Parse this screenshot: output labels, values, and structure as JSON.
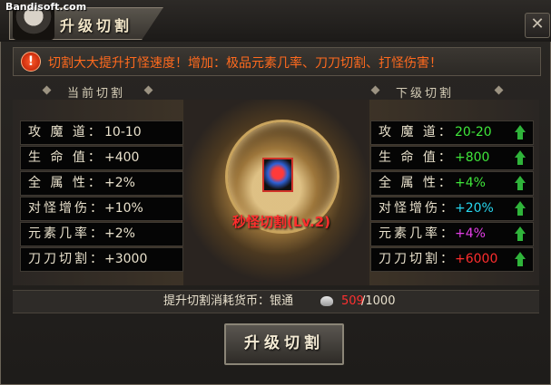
{
  "watermark": "Bandisoft.com",
  "window": {
    "title": "升级切割",
    "close_label": "✕"
  },
  "notice": {
    "icon": "alert-icon",
    "icon_glyph": "!",
    "text": "切割大大提升打怪速度！增加：极品元素几率、刀刀切割、打怪伤害！"
  },
  "current": {
    "header": "当前切割",
    "rows": [
      {
        "label": "攻 魔 道：",
        "value": "10-10"
      },
      {
        "label": "生  命  值：",
        "value": "+400"
      },
      {
        "label": "全  属  性：",
        "value": "+2%"
      },
      {
        "label": "对怪增伤：",
        "value": "+10%"
      },
      {
        "label": "元素几率：",
        "value": "+2%"
      },
      {
        "label": "刀刀切割：",
        "value": "+3000"
      }
    ]
  },
  "next": {
    "header": "下级切割",
    "rows": [
      {
        "label": "攻 魔 道：",
        "value": "20-20",
        "color": "#3fe63a"
      },
      {
        "label": "生  命  值：",
        "value": "+800",
        "color": "#3fe63a"
      },
      {
        "label": "全  属  性：",
        "value": "+4%",
        "color": "#3fe63a"
      },
      {
        "label": "对怪增伤：",
        "value": "+20%",
        "color": "#27d8f0"
      },
      {
        "label": "元素几率：",
        "value": "+4%",
        "color": "#e33ee6"
      },
      {
        "label": "刀刀切割：",
        "value": "+6000",
        "color": "#ff2d2d"
      }
    ]
  },
  "skill": {
    "name": "秒怪切割(Lv.2)",
    "icon": "skill-item-icon"
  },
  "cost": {
    "label": "提升切割消耗货币：银通",
    "currency_icon": "silver-coin-icon",
    "current": "509",
    "separator": "/",
    "required": "1000"
  },
  "button": {
    "label": "升级切割"
  }
}
